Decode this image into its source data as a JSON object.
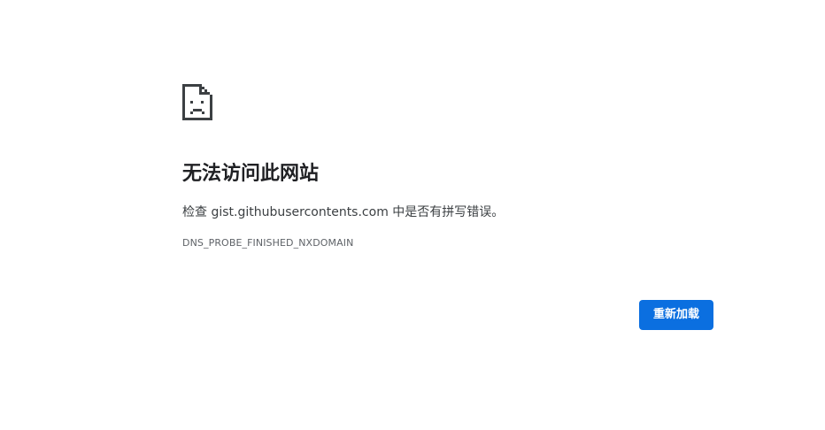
{
  "error": {
    "icon": "sad-page-icon",
    "title": "无法访问此网站",
    "message": "检查 gist.githubusercontents.com 中是否有拼写错误。",
    "code": "DNS_PROBE_FINISHED_NXDOMAIN"
  },
  "actions": {
    "reload_label": "重新加载"
  },
  "colors": {
    "background": "#ffffff",
    "title": "#202124",
    "text": "#3c4043",
    "code": "#5f6368",
    "button": "#0b6fe0",
    "button_text": "#ffffff"
  }
}
